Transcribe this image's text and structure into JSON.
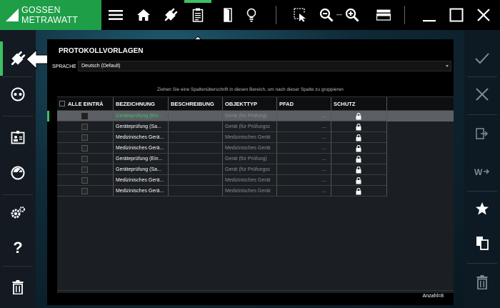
{
  "brand": {
    "name": "GOSSEN METRAWATT"
  },
  "toolbar": {
    "icons": [
      "menu-icon",
      "home-icon",
      "plug-icon",
      "clipboard-icon",
      "door-icon",
      "bulb-icon",
      "cursor-select-icon",
      "zoom-out-icon",
      "zoom-in-icon",
      "layout-icon",
      "minimize-icon",
      "maximize-icon",
      "close-icon"
    ]
  },
  "left_nav": {
    "icons": [
      "plug-icon",
      "socket-icon",
      "id-card-icon",
      "gauge-icon",
      "settings-icon",
      "help-icon",
      "trash-icon"
    ],
    "help_label": "?"
  },
  "right_nav": {
    "icons": [
      "check-icon",
      "x-icon",
      "export-icon",
      "word-export-icon",
      "star-icon",
      "copy-icon",
      "trash-icon"
    ]
  },
  "panel": {
    "title": "PROTOKOLLVORLAGEN",
    "language_label": "SPRACHE",
    "language_value": "Deutsch (Default)",
    "group_hint": "Ziehen Sie eine Spaltenüberschrift in diesen Bereich, um nach dieser Spalte zu gruppieren"
  },
  "table": {
    "columns": [
      "ALLE EINTRÄ",
      "BEZEICHNUNG",
      "BESCHREIBUNG",
      "OBJEKTTYP",
      "PFAD",
      "SCHUTZ"
    ],
    "rows": [
      {
        "bezeichnung": "Geräteprüfung (Ein...",
        "beschreibung": "",
        "objekttyp": "Gerät (für Prüfung)",
        "pfad": "...",
        "selected": true
      },
      {
        "bezeichnung": "Geräteprüfung (Sa...",
        "beschreibung": "",
        "objekttyp": "Gerät (für Prüfungsc",
        "pfad": "...",
        "selected": false
      },
      {
        "bezeichnung": "Medizinisches Gerä...",
        "beschreibung": "",
        "objekttyp": "Medizinisches Gerät",
        "pfad": "...",
        "selected": false
      },
      {
        "bezeichnung": "Medizinisches Gerä...",
        "beschreibung": "",
        "objekttyp": "Medizinisches Gerät",
        "pfad": "...",
        "selected": false
      },
      {
        "bezeichnung": "Geräteprüfung (Ein...",
        "beschreibung": "",
        "objekttyp": "Gerät (für Prüfung)",
        "pfad": "...",
        "selected": false
      },
      {
        "bezeichnung": "Geräteprüfung (Sa...",
        "beschreibung": "",
        "objekttyp": "Gerät (für Prüfungsc",
        "pfad": "...",
        "selected": false
      },
      {
        "bezeichnung": "Medizinisches Gerä...",
        "beschreibung": "",
        "objekttyp": "Medizinisches Gerät",
        "pfad": "...",
        "selected": false
      },
      {
        "bezeichnung": "Medizinisches Gerä...",
        "beschreibung": "",
        "objekttyp": "Medizinisches Gerät",
        "pfad": "...",
        "selected": false
      }
    ],
    "count_label": "Anzahl=8"
  },
  "colors": {
    "brand_green": "#1f9e48",
    "accent_green": "#3fc063",
    "selected_row": "#5c6066"
  }
}
